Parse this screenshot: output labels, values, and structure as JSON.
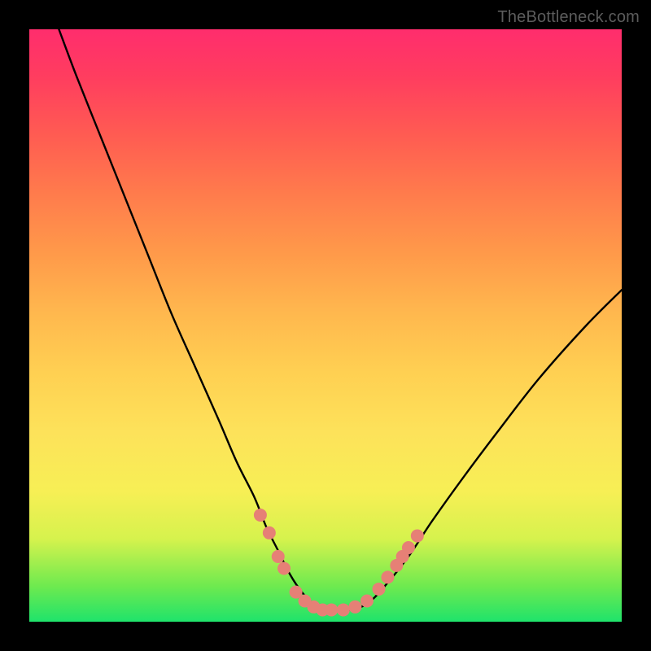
{
  "watermark": "TheBottleneck.com",
  "colors": {
    "page_bg": "#000000",
    "curve": "#000000",
    "marker": "#e68076",
    "watermark_text": "#5c5c5c",
    "gradient_top": "#ff2d6d",
    "gradient_bottom": "#1fe36b"
  },
  "chart_data": {
    "type": "line",
    "title": "",
    "xlabel": "",
    "ylabel": "",
    "xlim": [
      0,
      100
    ],
    "ylim": [
      0,
      100
    ],
    "grid": false,
    "legend": false,
    "series": [
      {
        "name": "bottleneck-curve",
        "x": [
          5,
          8,
          12,
          16,
          20,
          24,
          28,
          32,
          35,
          38,
          40,
          42,
          44,
          46,
          48,
          50,
          52,
          54,
          57,
          60,
          64,
          68,
          73,
          79,
          86,
          94,
          100
        ],
        "y": [
          100,
          92,
          82,
          72,
          62,
          52,
          43,
          34,
          27,
          21,
          16,
          12,
          8,
          5,
          3,
          2,
          2,
          2,
          3,
          6,
          11,
          17,
          24,
          32,
          41,
          50,
          56
        ]
      },
      {
        "name": "highlight-markers",
        "x": [
          39,
          40.5,
          42,
          43,
          45,
          46.5,
          48,
          49.5,
          51,
          53,
          55,
          57,
          59,
          60.5,
          62,
          63,
          64,
          65.5
        ],
        "y": [
          18,
          15,
          11,
          9,
          5,
          3.5,
          2.5,
          2,
          2,
          2,
          2.5,
          3.5,
          5.5,
          7.5,
          9.5,
          11,
          12.5,
          14.5
        ]
      }
    ]
  }
}
